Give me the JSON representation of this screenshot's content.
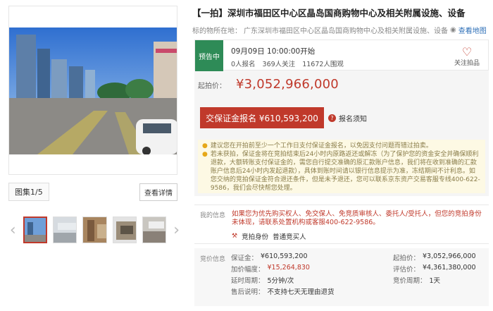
{
  "gallery": {
    "photo_count": "图集1/5",
    "detail_button": "查看详情",
    "prev_arrow": "‹",
    "next_arrow": "›",
    "thumbnails": [
      {
        "name": "thumb-1",
        "active": true
      },
      {
        "name": "thumb-2",
        "active": false
      },
      {
        "name": "thumb-3",
        "active": false
      },
      {
        "name": "thumb-4",
        "active": false
      },
      {
        "name": "thumb-5",
        "active": false
      }
    ]
  },
  "auction": {
    "title": "【一拍】深圳市福田区中心区晶岛国商购物中心及相关附属设施、设备",
    "location_label": "标的物所在地：",
    "location": "广东深圳市福田区中心区晶岛国商购物中心及相关附属设施、设备",
    "map_link": "查看地图",
    "status": "预告中",
    "start_time": "09月09日 10:00:00开始",
    "stats": [
      "0人报名",
      "369人关注",
      "11672人围观"
    ],
    "follow_label": "关注拍品",
    "start_price_label": "起拍价：",
    "start_price": "¥3,052,966,000",
    "deposit_button": "交保证金报名 ¥610,593,200",
    "rules_link": "报名须知",
    "notices": [
      "建议您在开拍前至少一个工作日支付保证金报名，以免因支付问题而错过拍卖。",
      "若未获拍，保证金将在竞拍结束后24小时内原路返还或解冻（为了保护您的资金安全并确保顺利退款，大额转账支付保证金的，需您自行提交准确的原汇款账户信息，我们将在收到准确的汇款账户信息后24小时内发起退款），具体到账时间请以银行信息提示为准，冻结期间不计利息。如您交纳的竞拍保证金符合退还条件，但是未予退还，您可以联系京东资产交易客服专线400-622-9586，我们会尽快帮您处理。"
    ]
  },
  "my_info": {
    "label": "我的信息",
    "warning": "如果您为优先购买权人、免交保人、免竞质审核人、委托人/受托人，但您的竞拍身份未体现，请联系处置机构或客服400-622-9586。",
    "identity_label": "竞拍身份",
    "identity_value": "普通竞买人"
  },
  "bid_info": {
    "label": "竞价信息",
    "rows": [
      {
        "lk": "保证金：",
        "lv": "¥610,593,200",
        "lred": false,
        "rk": "起拍价：",
        "rv": "¥3,052,966,000"
      },
      {
        "lk": "加价幅度：",
        "lv": "¥15,264,830",
        "lred": true,
        "rk": "评估价：",
        "rv": "¥4,361,380,000"
      },
      {
        "lk": "延时周期：",
        "lv": "5分钟/次",
        "lred": false,
        "rk": "竞价周期：",
        "rv": "1天"
      },
      {
        "lk": "售后说明：",
        "lv": "不支持七天无理由退货",
        "lred": false,
        "rk": "",
        "rv": ""
      }
    ]
  },
  "colors": {
    "accent": "#c0392b",
    "status_green": "#2e8b57",
    "notice_bg": "#fdf9e4",
    "link": "#2d6fb7"
  }
}
